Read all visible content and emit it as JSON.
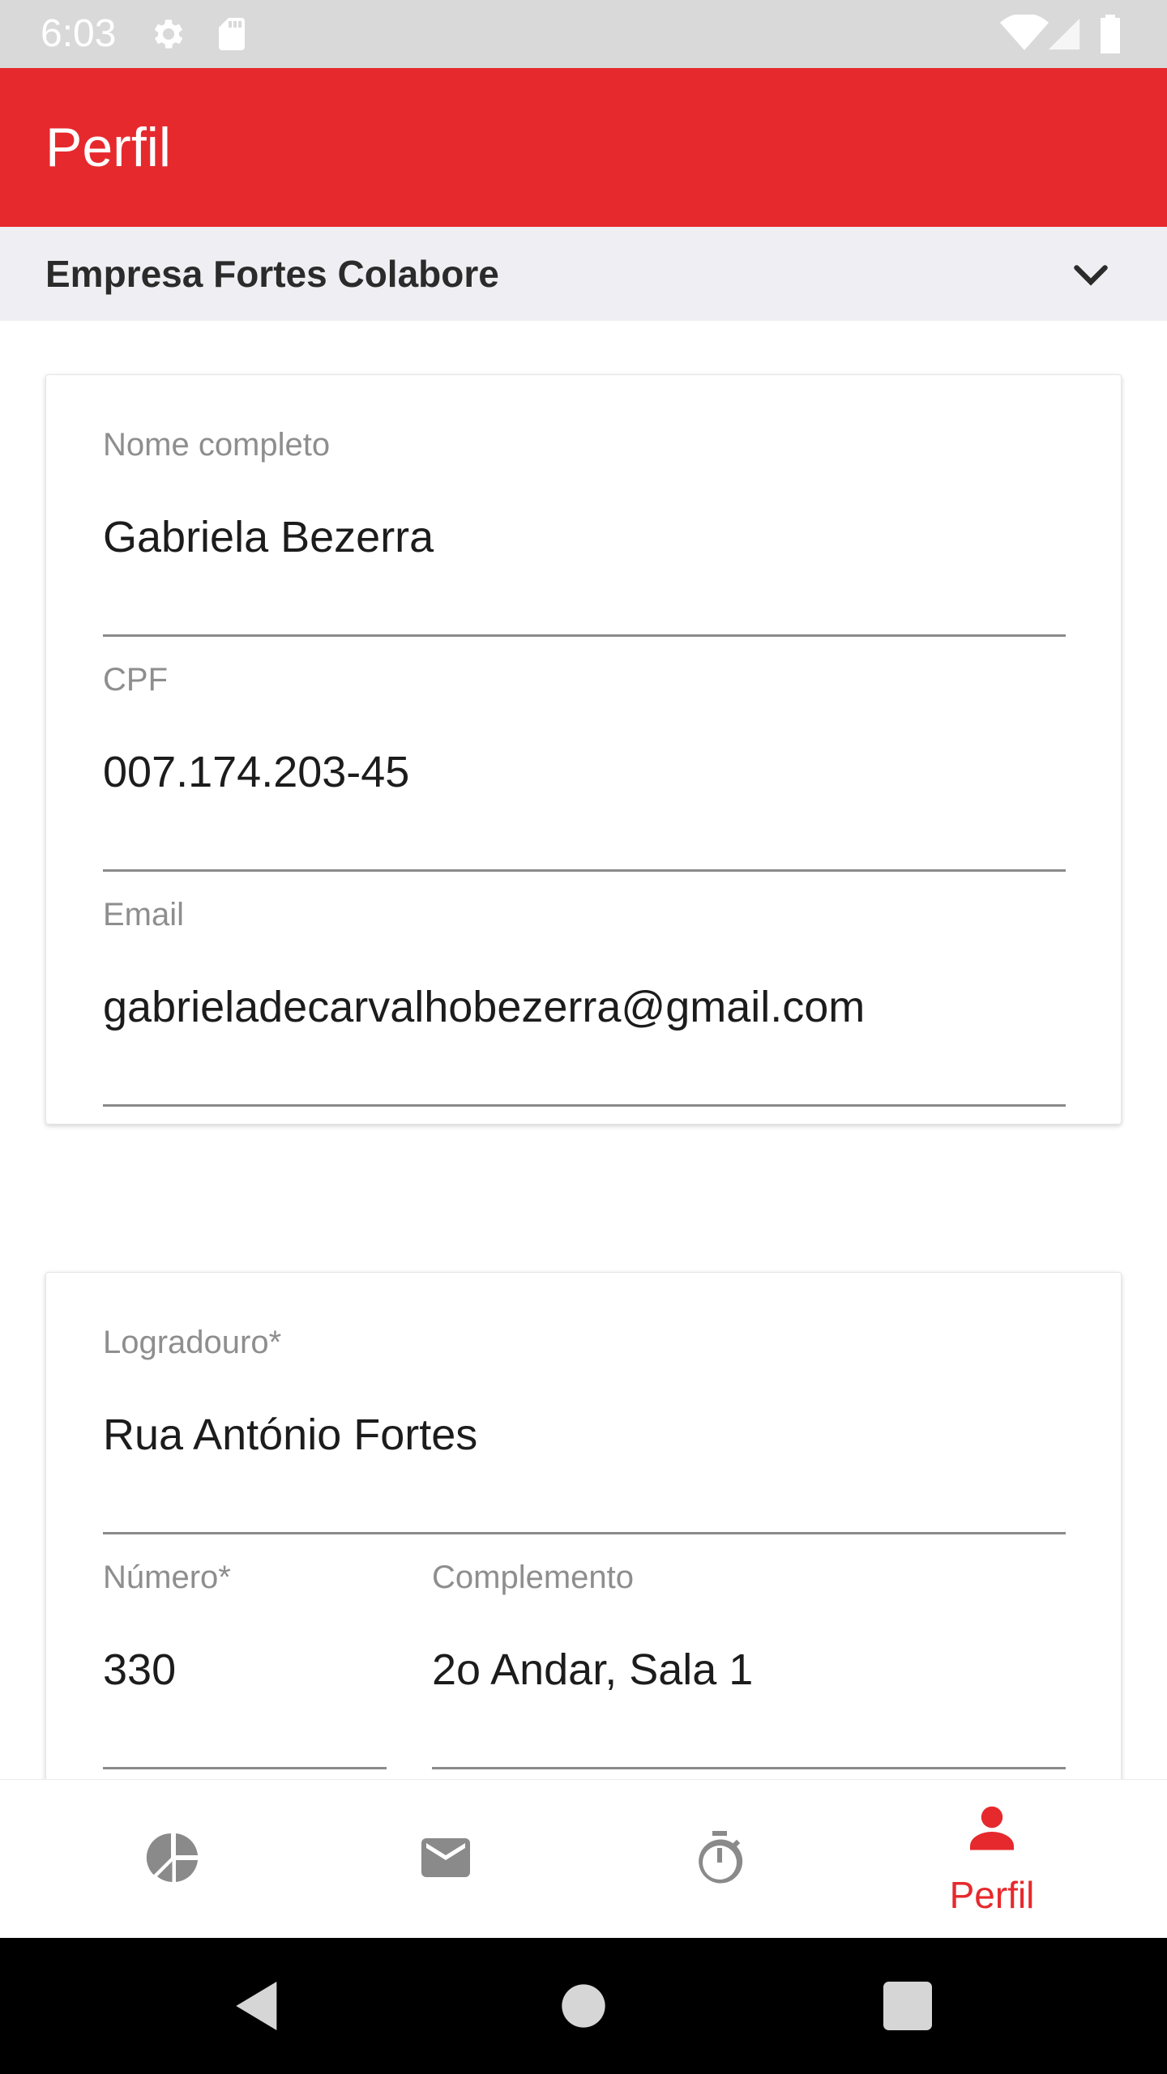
{
  "status_bar": {
    "time": "6:03"
  },
  "app_bar": {
    "title": "Perfil"
  },
  "company": {
    "name": "Empresa Fortes Colabore"
  },
  "personal": {
    "name_label": "Nome completo",
    "name_value": "Gabriela Bezerra",
    "cpf_label": "CPF",
    "cpf_value": "007.174.203-45",
    "email_label": "Email",
    "email_value": "gabrieladecarvalhobezerra@gmail.com"
  },
  "address": {
    "street_label": "Logradouro*",
    "street_value": "Rua António Fortes",
    "number_label": "Número*",
    "number_value": "330",
    "complement_label": "Complemento",
    "complement_value": "2o Andar, Sala 1"
  },
  "bottom_nav": {
    "items": [
      {
        "icon": "pie-chart-icon",
        "label": ""
      },
      {
        "icon": "mail-icon",
        "label": ""
      },
      {
        "icon": "stopwatch-icon",
        "label": ""
      },
      {
        "icon": "person-icon",
        "label": "Perfil"
      }
    ],
    "active_color": "#e6292d",
    "inactive_color": "#8a8a8a"
  },
  "colors": {
    "primary": "#e6292d",
    "status_bar": "#d9d9d9",
    "company_bar": "#efeff3"
  }
}
